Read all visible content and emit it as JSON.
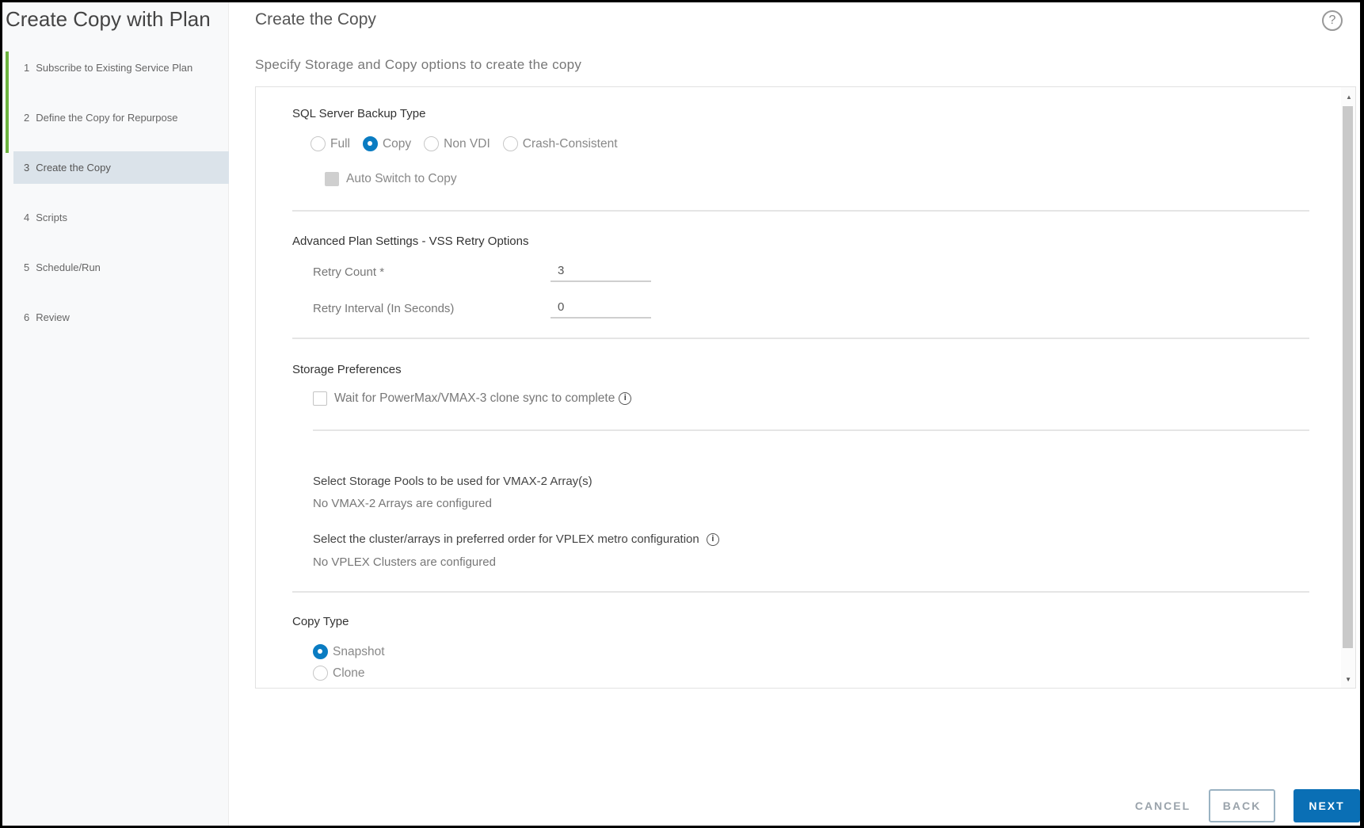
{
  "app": {
    "title": "Create Copy with Plan"
  },
  "steps": [
    {
      "num": "1",
      "label": "Subscribe to Existing Service Plan",
      "state": "completed"
    },
    {
      "num": "2",
      "label": "Define the Copy for Repurpose",
      "state": "completed"
    },
    {
      "num": "3",
      "label": "Create the Copy",
      "state": "active"
    },
    {
      "num": "4",
      "label": "Scripts",
      "state": "pending"
    },
    {
      "num": "5",
      "label": "Schedule/Run",
      "state": "pending"
    },
    {
      "num": "6",
      "label": "Review",
      "state": "pending"
    }
  ],
  "header": {
    "title": "Create the Copy",
    "subtitle": "Specify Storage and Copy options to create the copy",
    "help_icon": "question-circle-icon"
  },
  "backup_type": {
    "title": "SQL Server Backup Type",
    "options": [
      {
        "label": "Full",
        "checked": false
      },
      {
        "label": "Copy",
        "checked": true
      },
      {
        "label": "Non VDI",
        "checked": false
      },
      {
        "label": "Crash-Consistent",
        "checked": false
      }
    ],
    "auto_switch": {
      "label": "Auto Switch to Copy",
      "checked": false,
      "disabled": true
    }
  },
  "vss_retry": {
    "title": "Advanced Plan Settings - VSS Retry Options",
    "retry_count": {
      "label": "Retry Count *",
      "value": "3"
    },
    "retry_interval": {
      "label": "Retry Interval (In Seconds)",
      "value": "0"
    }
  },
  "storage_prefs": {
    "title": "Storage Preferences",
    "wait_clone_sync": {
      "label": "Wait for PowerMax/VMAX-3 clone sync to complete",
      "checked": false
    },
    "vmax2": {
      "title": "Select Storage Pools to be used for VMAX-2 Array(s)",
      "message": "No VMAX-2 Arrays are configured"
    },
    "vplex": {
      "title": "Select the cluster/arrays in preferred order for VPLEX metro configuration",
      "message": "No VPLEX Clusters are configured"
    }
  },
  "copy_type": {
    "title": "Copy Type",
    "options": [
      {
        "label": "Snapshot",
        "checked": true
      },
      {
        "label": "Clone",
        "checked": false
      }
    ]
  },
  "footer": {
    "cancel": "CANCEL",
    "back": "BACK",
    "next": "NEXT"
  },
  "colors": {
    "accent": "#0a7cc2",
    "step_complete": "#6cb33f",
    "active_step_bg": "#dbe3ea",
    "next_button": "#0a6fb5"
  }
}
